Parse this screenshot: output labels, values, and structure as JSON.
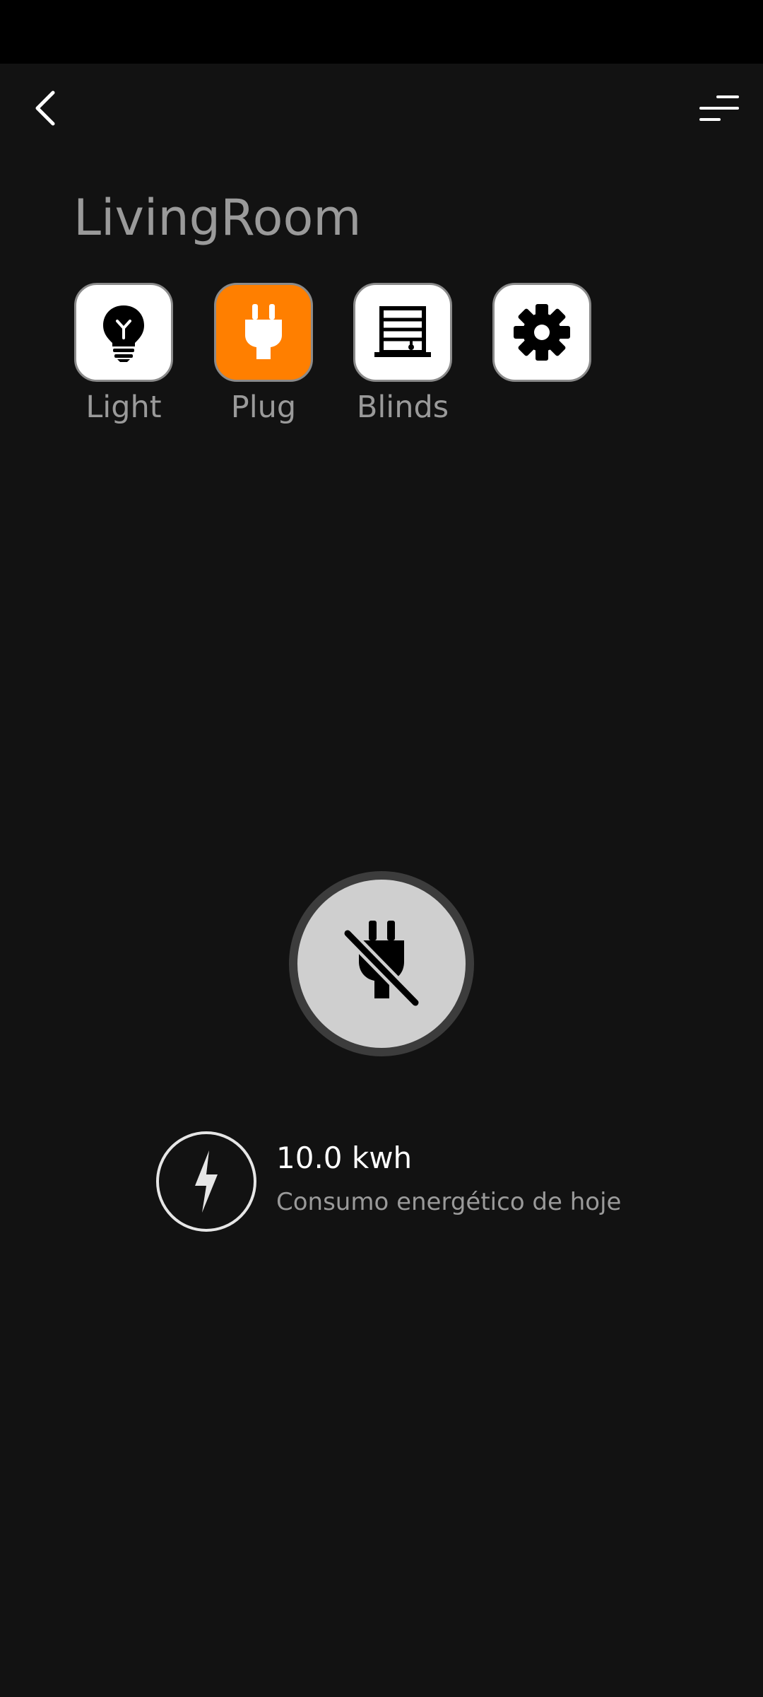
{
  "header": {
    "back_icon": "chevron-left-icon",
    "menu_icon": "menu-lines-icon"
  },
  "room": {
    "title": "LivingRoom"
  },
  "tabs": [
    {
      "label": "Light",
      "icon": "lightbulb-icon",
      "active": false
    },
    {
      "label": "Plug",
      "icon": "plug-icon",
      "active": true
    },
    {
      "label": "Blinds",
      "icon": "blinds-icon",
      "active": false
    },
    {
      "label": "",
      "icon": "gear-icon",
      "active": false
    }
  ],
  "power": {
    "icon": "plug-off-icon",
    "state": "off"
  },
  "energy": {
    "icon": "lightning-bolt-icon",
    "value": "10.0 kwh",
    "caption": "Consumo energético de hoje"
  },
  "colors": {
    "background": "#121212",
    "accent": "#ff7f00",
    "tab_background": "#ffffff",
    "muted_text": "#9a9a9a",
    "power_button_fill": "#cfcfcf",
    "power_button_ring": "#3c3c3c"
  }
}
